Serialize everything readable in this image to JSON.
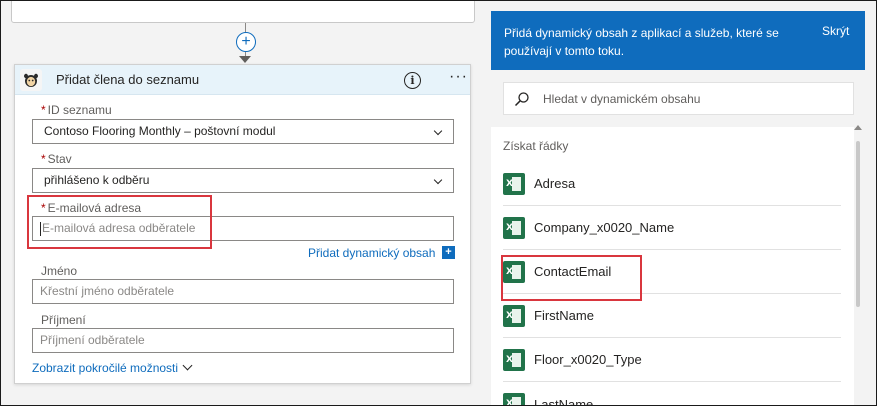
{
  "flow": {
    "add_step_symbol": "+"
  },
  "card": {
    "title": "Přidat člena do seznamu",
    "info_symbol": "i",
    "more_symbol": "···",
    "required_mark": "*",
    "fields": {
      "list_id": {
        "label": "ID seznamu",
        "value": "Contoso Flooring Monthly – poštovní modul",
        "required": true
      },
      "status": {
        "label": "Stav",
        "value": "přihlášeno k odběru",
        "required": true
      },
      "email": {
        "label": "E-mailová adresa",
        "placeholder": "E-mailová adresa odběratele",
        "required": true
      },
      "first_name": {
        "label": "Jméno",
        "placeholder": "Křestní jméno odběratele"
      },
      "last_name": {
        "label": "Příjmení",
        "placeholder": "Příjmení odběratele"
      }
    },
    "add_dynamic_link": "Přidat dynamický obsah",
    "add_dynamic_symbol": "+",
    "advanced_link": "Zobrazit pokročilé možnosti"
  },
  "dynamic_panel": {
    "description": "Přidá dynamický obsah z aplikací a služeb, které se používají v tomto toku.",
    "close_label": "Skrýt",
    "search_placeholder": "Hledat v dynamickém obsahu",
    "section_title": "Získat řádky",
    "items": [
      {
        "label": "Adresa",
        "icon": "excel-icon"
      },
      {
        "label": "Company_x0020_Name",
        "icon": "excel-icon"
      },
      {
        "label": "ContactEmail",
        "icon": "excel-icon"
      },
      {
        "label": "FirstName",
        "icon": "excel-icon"
      },
      {
        "label": "Floor_x0020_Type",
        "icon": "excel-icon"
      },
      {
        "label": "LastName",
        "icon": "excel-icon"
      }
    ]
  },
  "colors": {
    "accent": "#0f6cbd",
    "highlight": "#d9363e",
    "excel_green": "#21734a"
  }
}
